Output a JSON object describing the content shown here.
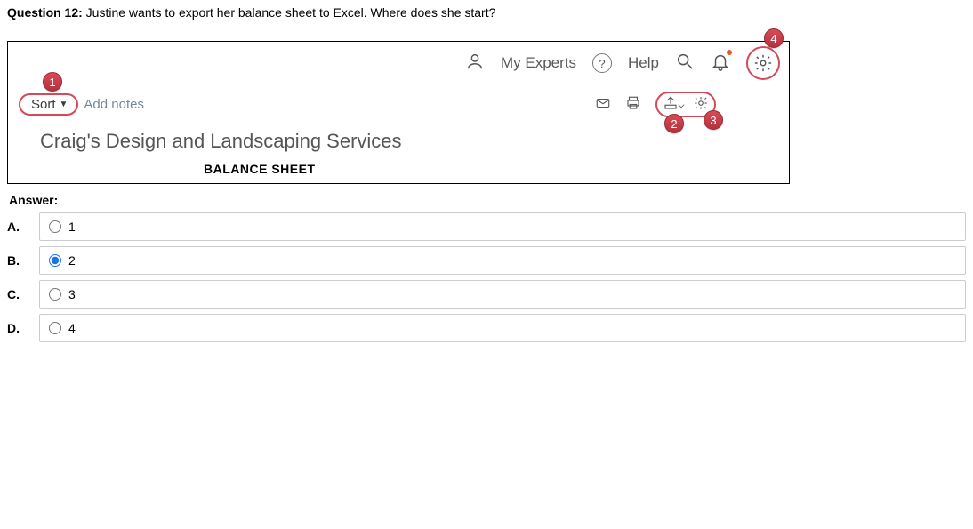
{
  "question": {
    "prefix": "Question 12:",
    "text": " Justine wants to export her balance sheet to Excel. Where does she start?"
  },
  "topbar": {
    "my_experts": "My Experts",
    "help": "Help"
  },
  "reportbar": {
    "sort": "Sort",
    "add_notes": "Add notes"
  },
  "badges": {
    "b1": "1",
    "b2": "2",
    "b3": "3",
    "b4": "4"
  },
  "report": {
    "company": "Craig's Design and Landscaping Services",
    "title": "BALANCE SHEET"
  },
  "answer": {
    "label": "Answer:"
  },
  "options": {
    "a": {
      "letter": "A.",
      "text": "1"
    },
    "b": {
      "letter": "B.",
      "text": "2"
    },
    "c": {
      "letter": "C.",
      "text": "3"
    },
    "d": {
      "letter": "D.",
      "text": "4"
    }
  }
}
